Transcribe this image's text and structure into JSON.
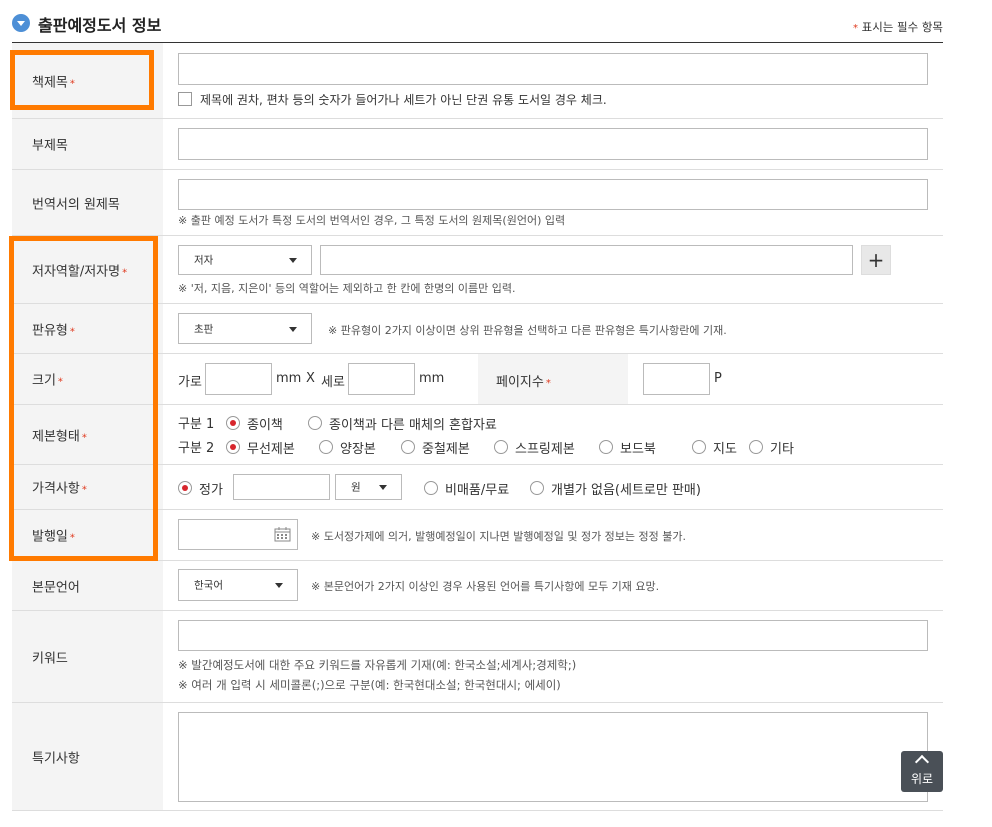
{
  "header": {
    "title": "출판예정도서 정보",
    "required_note": "표시는 필수 항목",
    "star": "*"
  },
  "rows": {
    "book_title": {
      "label": "책제목",
      "checkbox_label": "제목에 권차, 편차 등의 숫자가 들어가나 세트가 아닌 단권 유통 도서일 경우 체크."
    },
    "subtitle": {
      "label": "부제목"
    },
    "original_title": {
      "label": "번역서의 원제목",
      "note": "※ 출판 예정 도서가 특정 도서의 번역서인 경우, 그 특정 도서의 원제목(원언어) 입력"
    },
    "author": {
      "label": "저자역할/저자명",
      "role_selected": "저자",
      "add": "+",
      "note": "※ '저, 지음, 지은이' 등의 역할어는 제외하고 한 칸에 한명의 이름만 입력."
    },
    "edition": {
      "label": "판유형",
      "selected": "초판",
      "note": "※ 판유형이 2가지 이상이면 상위 판유형을 선택하고 다른 판유형은 특기사항란에 기재."
    },
    "size": {
      "label": "크기",
      "width_label": "가로",
      "mm1": "mm",
      "x": "X",
      "height_label": "세로",
      "mm2": "mm",
      "pages_label": "페이지수",
      "p": "P"
    },
    "binding": {
      "label": "제본형태",
      "group1_label": "구분 1",
      "group1_options": [
        "종이책",
        "종이책과 다른 매체의 혼합자료"
      ],
      "group2_label": "구분 2",
      "group2_options": [
        "무선제본",
        "양장본",
        "중철제본",
        "스프링제본",
        "보드북",
        "지도",
        "기타"
      ]
    },
    "price": {
      "label": "가격사항",
      "fixed_label": "정가",
      "currency": "원",
      "free_label": "비매품/무료",
      "no_single_label": "개별가 없음(세트로만 판매)"
    },
    "pub_date": {
      "label": "발행일",
      "note": "※ 도서정가제에 의거, 발행예정일이 지나면 발행예정일 및 정가 정보는 정정 불가."
    },
    "language": {
      "label": "본문언어",
      "selected": "한국어",
      "note": "※ 본문언어가 2가지 이상인 경우 사용된 언어를 특기사항에 모두 기재 요망."
    },
    "keywords": {
      "label": "키워드",
      "note1": "※ 발간예정도서에 대한 주요 키워드를 자유롭게 기재(예: 한국소설;세계사;경제학;)",
      "note2": "※ 여러 개 입력 시 세미콜론(;)으로 구분(예: 한국현대소설; 한국현대시; 에세이)"
    },
    "remarks": {
      "label": "특기사항"
    }
  },
  "top_button": {
    "label": "위로"
  },
  "colors": {
    "accent_orange": "#ff7a00",
    "required_red": "#e03a1f",
    "header_icon_blue": "#4d8fd6"
  }
}
